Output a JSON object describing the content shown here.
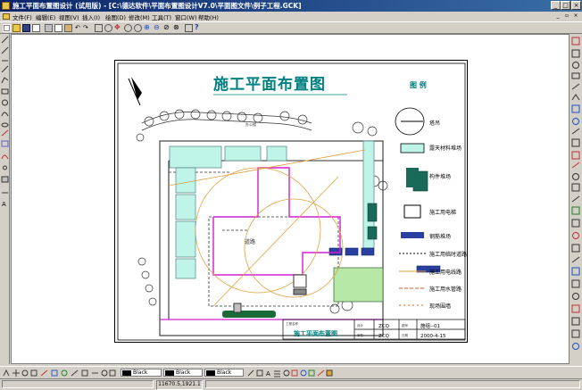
{
  "window": {
    "title": "施工平面布置图设计 (试用版) - [C:\\德达软件\\平面布置图设计V7.0\\平面图文件\\例子工程.GCK]",
    "buttons": {
      "minimize": "_",
      "maximize": "□",
      "close": "×"
    }
  },
  "menu": [
    {
      "label": "文件(F)"
    },
    {
      "label": "编辑(E)"
    },
    {
      "label": "视图(V)"
    },
    {
      "label": "插入(I)"
    },
    {
      "label": "绘图(D)"
    },
    {
      "label": "修改(M)"
    },
    {
      "label": "工具(T)"
    },
    {
      "label": "窗口(W)"
    },
    {
      "label": "帮助(H)"
    }
  ],
  "drawing": {
    "title": "施工平面布置图",
    "legend_title": "图    例",
    "legend": [
      {
        "label": "塔吊"
      },
      {
        "label": "露天材料堆场"
      },
      {
        "label": "构件堆场"
      },
      {
        "label": "施工用电梯"
      },
      {
        "label": "钢筋堆场"
      },
      {
        "label": "施工用临时道路"
      },
      {
        "label": "施工用电线路"
      },
      {
        "label": "施工用水管路"
      },
      {
        "label": "现场围墙"
      }
    ],
    "title_block": {
      "project_label": "工程名称",
      "drawing_name": "施工平面布置图",
      "designer_label": "设计",
      "designer": "ZCQ",
      "checker_label": "审核",
      "checker": "ZCQ",
      "sheet_no_label": "图号",
      "sheet_no": "施组--01",
      "date_label": "日期",
      "date": "2000-4-15"
    },
    "site_labels": {
      "building": "办公楼",
      "road": "道路"
    }
  },
  "bottom_toolbar": {
    "color_boxes": [
      {
        "value": "Black"
      },
      {
        "value": "Black"
      },
      {
        "value": "Black"
      }
    ]
  },
  "status": {
    "coords": "11670.5,1921.1"
  },
  "colors": {
    "titlebar_start": "#0a246a",
    "titlebar_end": "#3a6ea5",
    "title_text": "#008080",
    "boundary": "#d020d0",
    "road": "#303030",
    "power_line": "#e0a040",
    "material_yard": "#bff5e8",
    "component_yard": "#1a6a5a",
    "rebar_yard": "#2a40a0",
    "green_area": "#b8e8a8"
  }
}
